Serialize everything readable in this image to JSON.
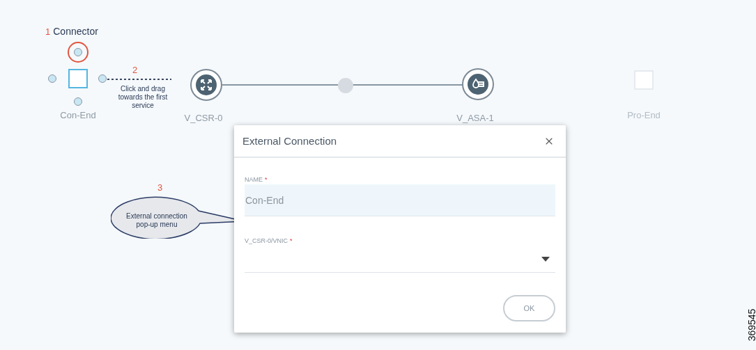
{
  "canvas": {
    "connector_annotation": {
      "number": "1",
      "label": "Connector"
    },
    "drag_annotation": {
      "number": "2",
      "text": "Click and drag towards the first service"
    },
    "popup_annotation": {
      "number": "3",
      "text": "External connection pop-up menu"
    },
    "nodes": [
      {
        "kind": "endpoint",
        "label": "Con-End",
        "active": true
      },
      {
        "kind": "router",
        "label": "V_CSR-0"
      },
      {
        "kind": "firewall",
        "label": "V_ASA-1"
      },
      {
        "kind": "endpoint",
        "label": "Pro-End",
        "active": false
      }
    ]
  },
  "dialog": {
    "title": "External Connection",
    "fields": [
      {
        "kind": "text",
        "label": "NAME",
        "required_mark": "*",
        "value": "Con-End"
      },
      {
        "kind": "select",
        "label": "V_CSR-0/VNIC",
        "required_mark": "*"
      }
    ],
    "buttons": [
      "OK"
    ]
  },
  "figure_number": "369545"
}
